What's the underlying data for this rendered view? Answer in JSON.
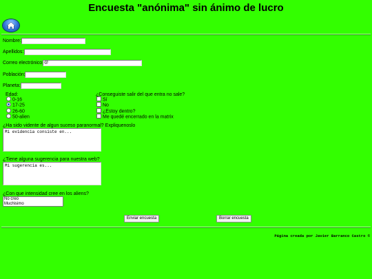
{
  "page": {
    "title": "Encuesta \"anónima\" sin ánimo de lucro"
  },
  "nav": {
    "home_icon": "home-icon"
  },
  "form": {
    "nombre_label": "Nombre:",
    "nombre_value": "",
    "apellidos_label": "Apellidos:",
    "apellidos_value": "",
    "correo_label": "Correo electrónico:",
    "correo_value": "@",
    "poblacion_label": "Población:",
    "poblacion_value": "",
    "planeta_label": "Planeta:",
    "planeta_value": "",
    "edad": {
      "label": "Edad:",
      "options": [
        "0-16",
        "17-25",
        "26-60",
        "50-alien"
      ],
      "selected": "17-25"
    },
    "salir": {
      "label": "¿Conseguiste salir del que entra no sale?",
      "options": [
        "Sí",
        "No",
        "¿Estoy dentro?",
        "Me quedé encerrado en la matrix"
      ]
    },
    "evidencia": {
      "label": "¿Ha sido vidente de algun suceso paranormal? Expliquenoslo",
      "value": "Mi evidencia consiste en..."
    },
    "sugerencia": {
      "label": "¿Tiene alguna sugerencia para nuestra web?",
      "value": "Mi sugerencia es..."
    },
    "intensidad": {
      "label": "¿Con que intensidad cree en los aliens?",
      "options": [
        "No creo",
        "Muchisimo"
      ]
    },
    "enviar_label": "Enviar encuesta",
    "borrar_label": "Borrar encuesta"
  },
  "footer": {
    "text": "Página creada por Javier Barranco Castro ©"
  },
  "colors": {
    "background": "#33ff00"
  }
}
